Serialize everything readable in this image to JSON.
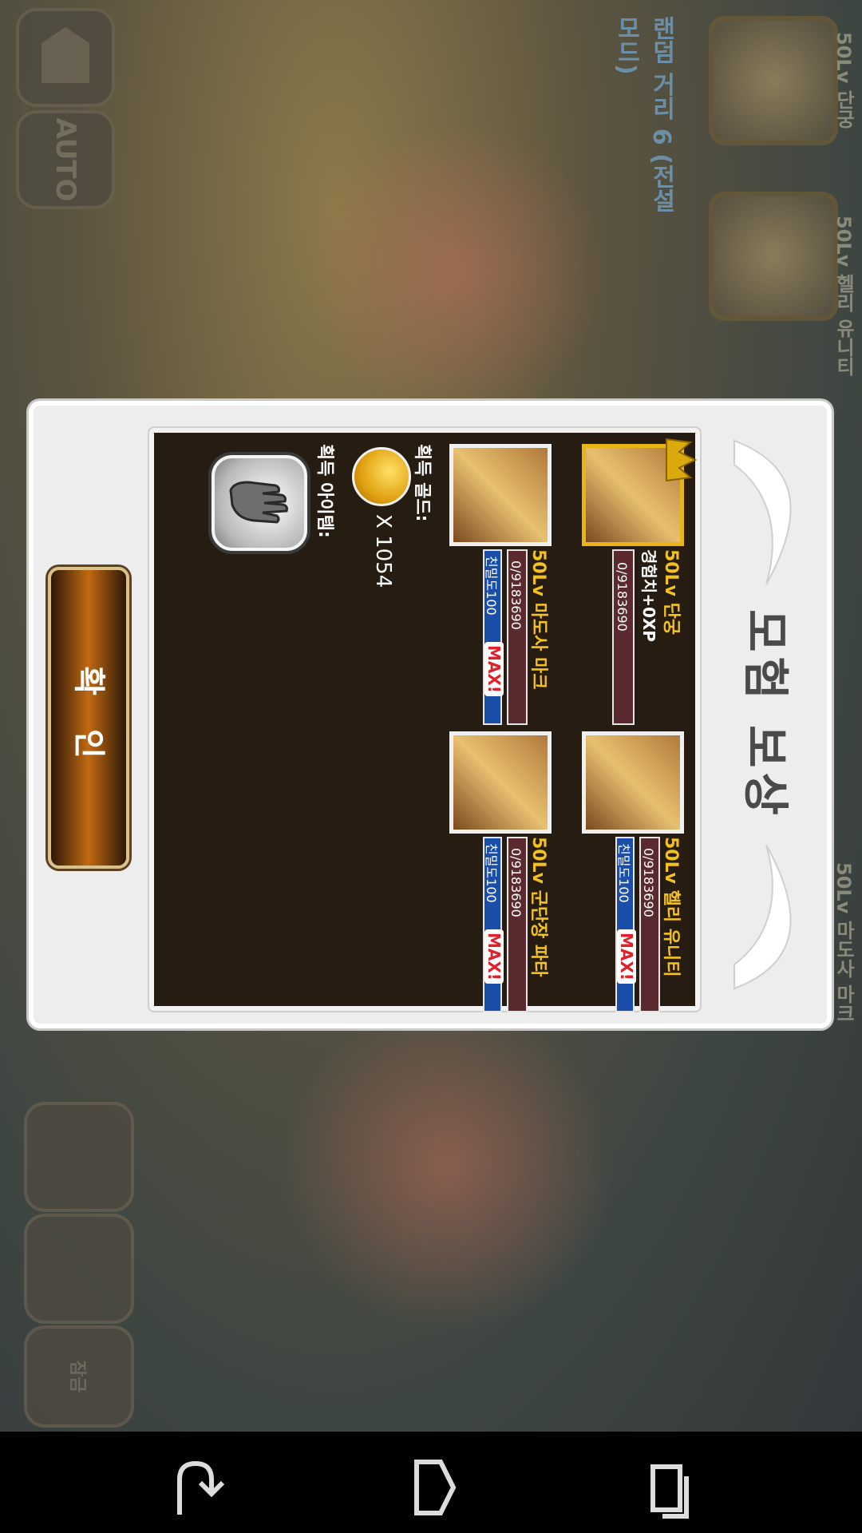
{
  "hud": {
    "home_icon": "home-icon",
    "auto_label": "AUTO",
    "stage_title": "랜덤 거리 6 (전설모드)",
    "party": [
      {
        "name": "50Lv 단궁"
      },
      {
        "name": "50Lv 헬리 유니티"
      },
      {
        "name": "50Lv 마도사 마크"
      }
    ],
    "lock_label": "잠금"
  },
  "dialog": {
    "title": "모험 보상",
    "heroes": [
      {
        "level_name": "50Lv 단궁",
        "exp_text": "경험치+0XP",
        "xp": "0/9183690",
        "selected": true
      },
      {
        "level_name": "50Lv 헬리 유니티",
        "xp": "0/9183690",
        "affinity": "친밀도100",
        "max": "MAX!"
      },
      {
        "level_name": "50Lv 마도사 마크",
        "xp": "0/9183690",
        "affinity": "친밀도100",
        "max": "MAX!"
      },
      {
        "level_name": "50Lv 군단장 파타",
        "xp": "0/9183690",
        "affinity": "친밀도100",
        "max": "MAX!"
      }
    ],
    "gold_label": "획득 골드:",
    "gold_amount": "X 1054",
    "item_label": "획득 아이템:",
    "item_icon": "gauntlet-icon",
    "confirm_label": "확 인"
  },
  "nav": {
    "back_icon": "back-icon",
    "home_icon": "home-nav-icon",
    "recents_icon": "recent-apps-icon"
  }
}
